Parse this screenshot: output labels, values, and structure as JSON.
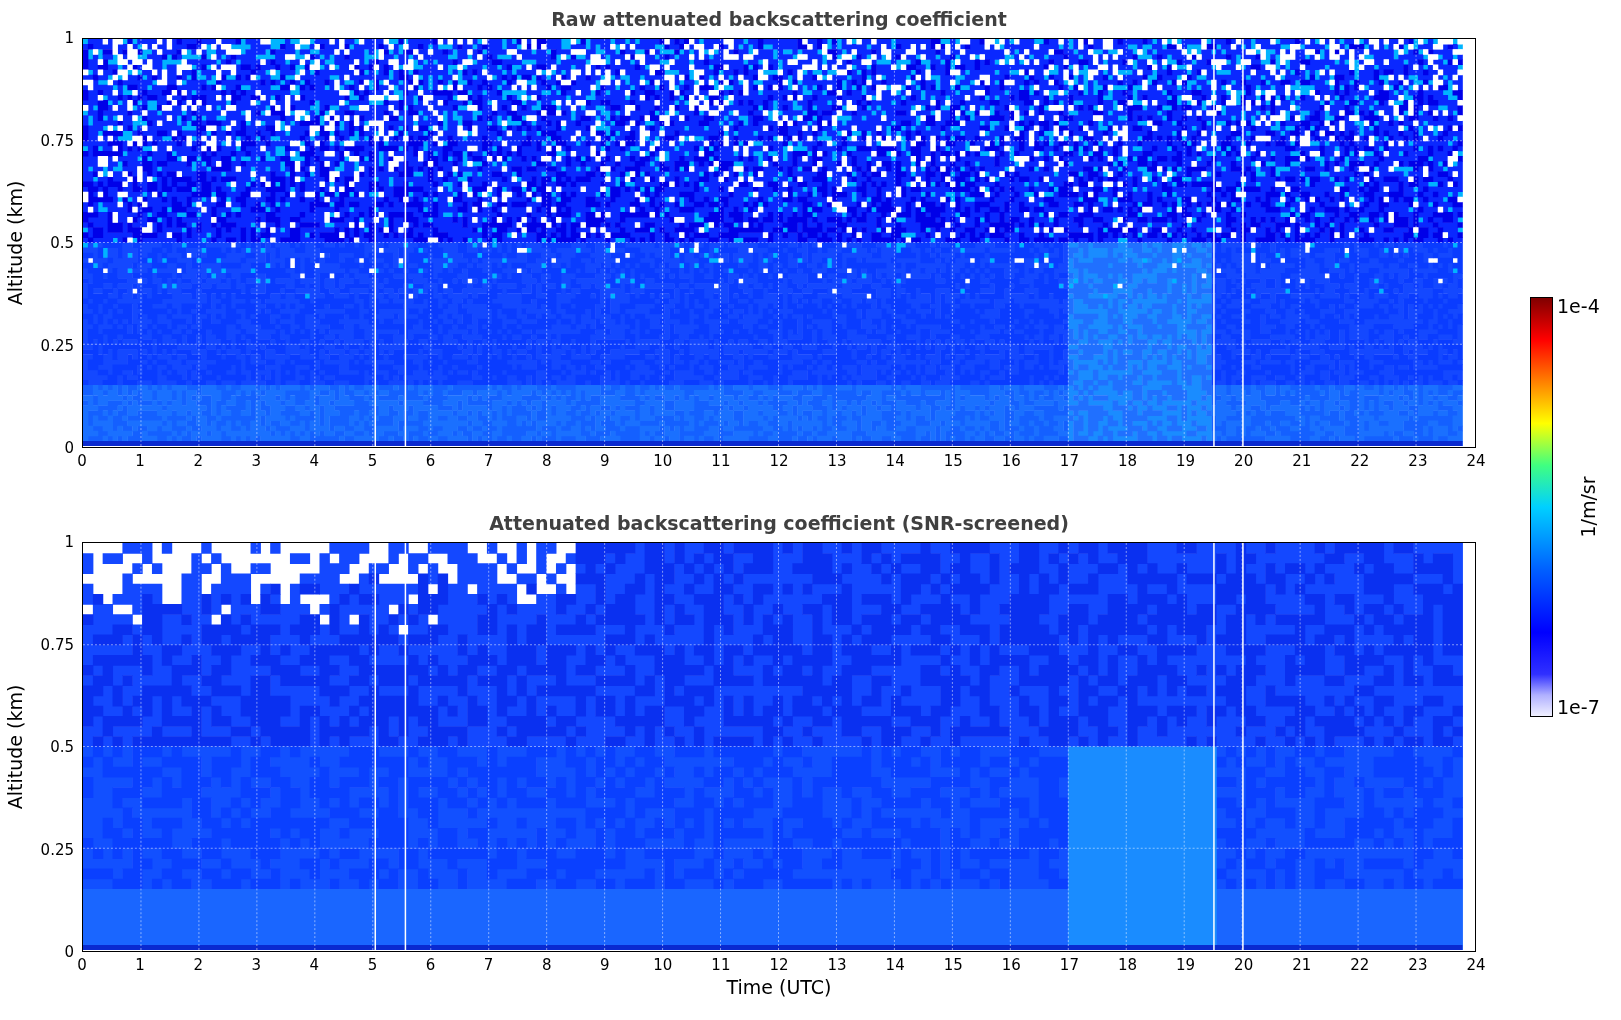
{
  "panels": [
    {
      "kind": "raw",
      "title": "Raw attenuated backscattering coefficient",
      "ylabel": "Altitude (km)",
      "yticks": [
        "1",
        "0.75",
        "0.5",
        "0.25",
        "0"
      ],
      "xticks": [
        "0",
        "1",
        "2",
        "3",
        "4",
        "5",
        "6",
        "7",
        "8",
        "9",
        "10",
        "11",
        "12",
        "13",
        "14",
        "15",
        "16",
        "17",
        "18",
        "19",
        "20",
        "21",
        "22",
        "23",
        "24"
      ]
    },
    {
      "kind": "screened",
      "title": "Attenuated backscattering coefficient (SNR-screened)",
      "ylabel": "Altitude (km)",
      "yticks": [
        "1",
        "0.75",
        "0.5",
        "0.25",
        "0"
      ],
      "xticks": [
        "0",
        "1",
        "2",
        "3",
        "4",
        "5",
        "6",
        "7",
        "8",
        "9",
        "10",
        "11",
        "12",
        "13",
        "14",
        "15",
        "16",
        "17",
        "18",
        "19",
        "20",
        "21",
        "22",
        "23",
        "24"
      ]
    }
  ],
  "xlabel": "Time (UTC)",
  "colorbar": {
    "max": "1e-4",
    "min": "1e-7",
    "label": "1/m/sr"
  }
}
